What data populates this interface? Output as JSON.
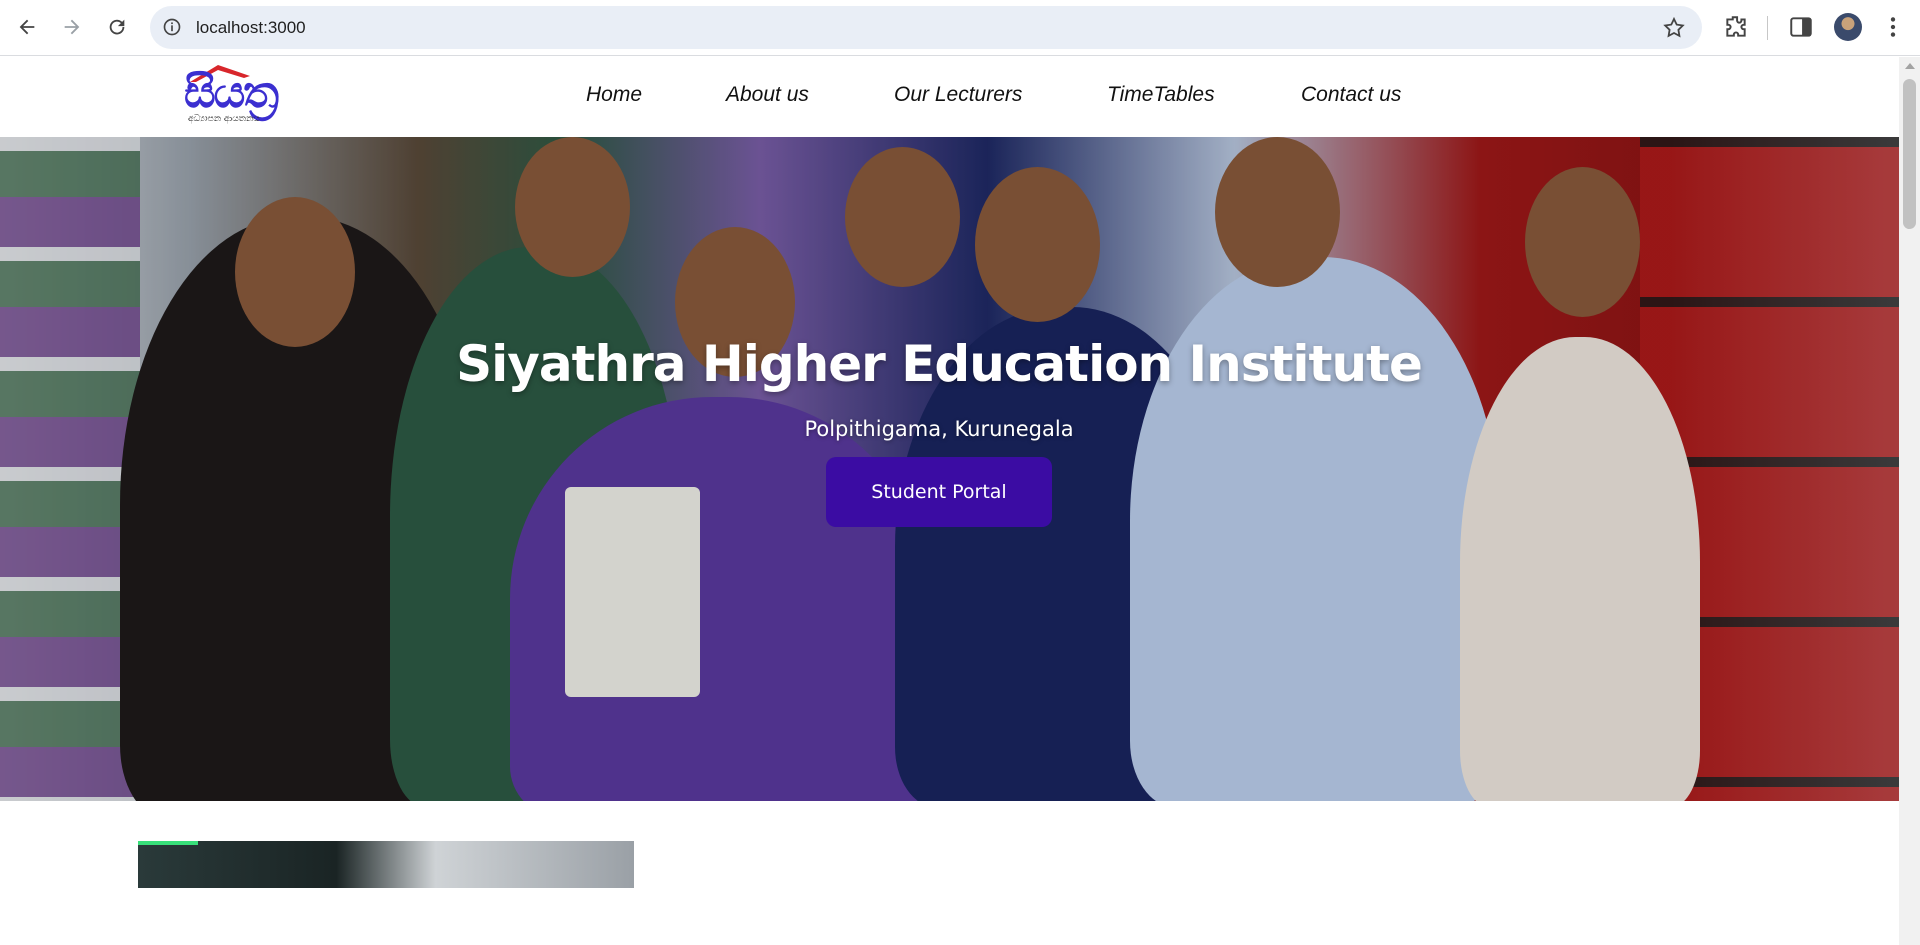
{
  "browser": {
    "url": "localhost:3000"
  },
  "site": {
    "logo_text": "සියත්‍ර",
    "logo_subtext": "අධ්‍යාපන ආයතනය",
    "nav": [
      {
        "label": "Home"
      },
      {
        "label": "About us"
      },
      {
        "label": "Our Lecturers"
      },
      {
        "label": "TimeTables"
      },
      {
        "label": "Contact us"
      }
    ]
  },
  "hero": {
    "title": "Siyathra Higher Education Institute",
    "subtitle": "Polpithigama, Kurunegala",
    "button_label": "Student Portal"
  },
  "colors": {
    "accent": "#3b0ca3",
    "logo": "#3b2fd0",
    "logo_roof": "#d8262b"
  }
}
